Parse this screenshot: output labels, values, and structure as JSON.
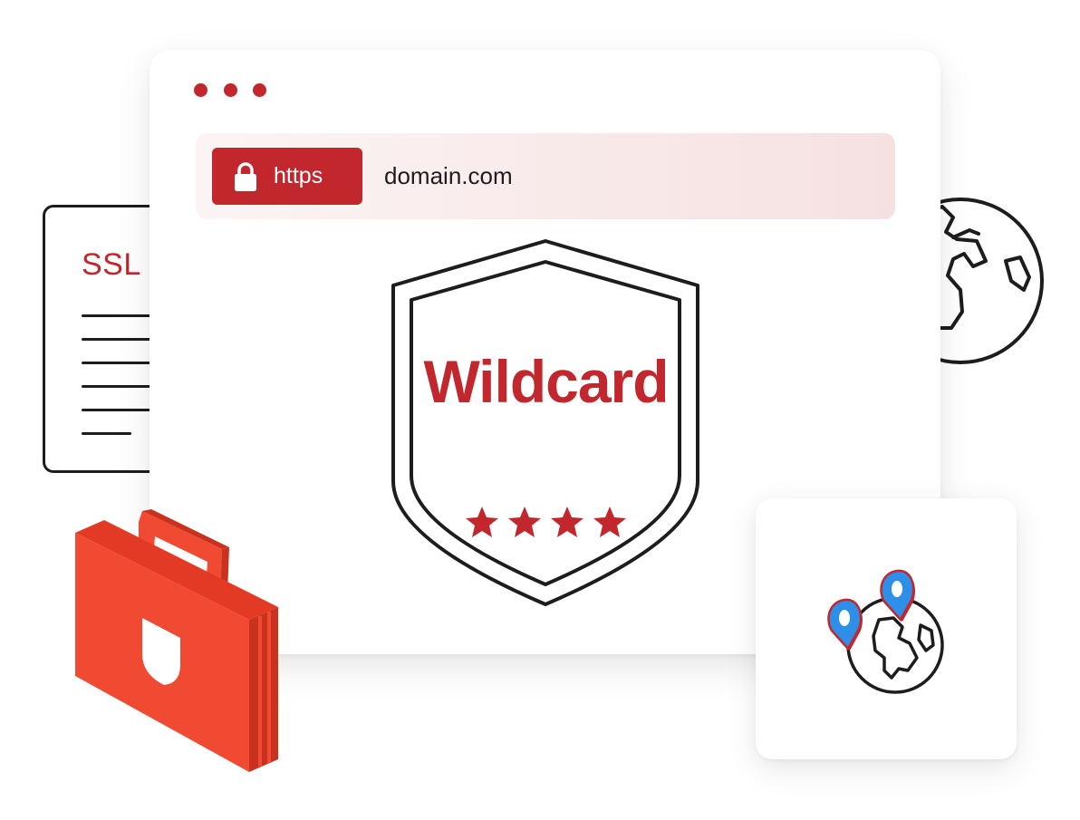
{
  "ssl_document": {
    "title": "SSL",
    "icon": "document-icon"
  },
  "browser": {
    "window_dots": [
      "dot",
      "dot",
      "dot"
    ],
    "address_bar": {
      "protocol_label": "https",
      "lock_icon": "lock-icon",
      "domain": "domain.com"
    },
    "shield": {
      "label": "Wildcard",
      "stars": 4,
      "icon": "shield-icon"
    }
  },
  "icons": {
    "globe": "globe-icon",
    "briefcase": "briefcase-icon",
    "location_pin": "location-pin-icon"
  },
  "colors": {
    "accent_red": "#c1272d",
    "briefcase_orange": "#f04a32",
    "briefcase_dark": "#c8321f",
    "pin_blue": "#2e8fe8",
    "outline": "#1d1d1f",
    "address_bar_bg": "#f6e1e1"
  }
}
